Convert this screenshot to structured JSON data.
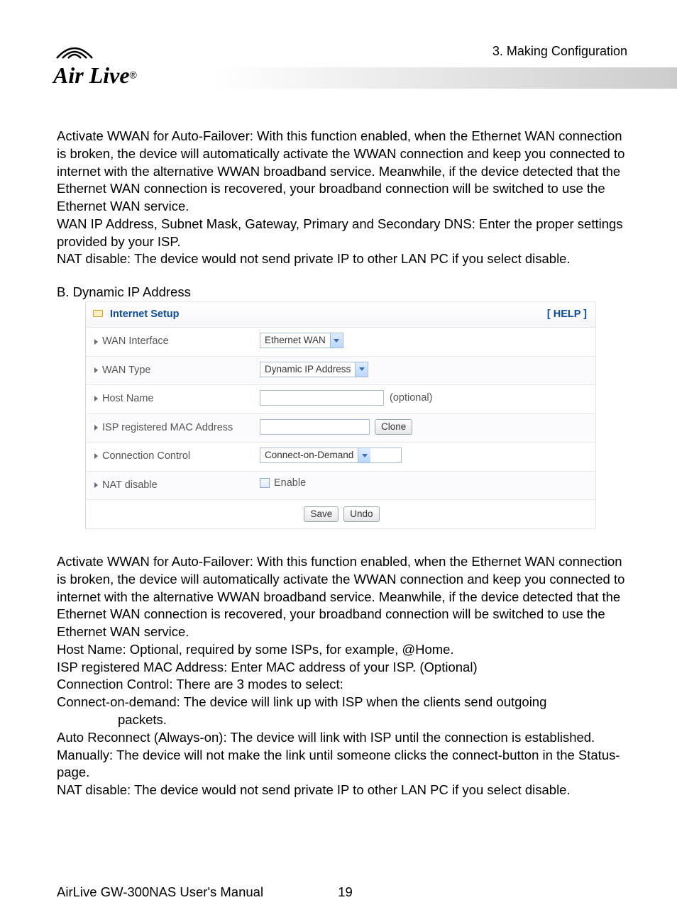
{
  "header": {
    "chapter": "3.  Making  Configuration",
    "logo_text": "Air Live",
    "logo_reg": "®"
  },
  "body_text": {
    "top_p1": "Activate WWAN for Auto-Failover: With this function enabled, when the Ethernet WAN connection is broken, the device will automatically activate the WWAN connection and keep you connected to internet with the alternative WWAN broadband service. Meanwhile, if the device detected that the Ethernet WAN connection is recovered, your broadband connection will be switched to use the Ethernet WAN service.",
    "top_p2": "WAN IP Address, Subnet Mask, Gateway, Primary and Secondary DNS: Enter the proper settings provided by your ISP.",
    "top_p3": "NAT disable: The device would not send private IP to other LAN PC if you select disable.",
    "section_b": "B. Dynamic IP Address",
    "low_p1": "Activate WWAN for Auto-Failover: With this function enabled, when the Ethernet WAN connection is broken, the device will automatically activate the WWAN connection and keep you connected to internet with the alternative WWAN broadband service. Meanwhile, if the device detected that the Ethernet WAN connection is recovered, your broadband connection will be switched to use the Ethernet WAN service.",
    "low_p2": "Host Name: Optional, required by some ISPs, for example, @Home.",
    "low_p3": "ISP registered MAC Address: Enter MAC address of your ISP. (Optional)",
    "low_p4": "Connection Control: There are 3 modes to select:",
    "low_p5a": "Connect-on-demand: The device will link up with ISP when the clients send outgoing",
    "low_p5b": "packets.",
    "low_p6": "Auto Reconnect (Always-on): The device will link with ISP until the connection is established.",
    "low_p7": "Manually: The device will not make the link until someone clicks the connect-button in the Status-page.",
    "low_p8": "NAT disable: The device would not send private IP to other LAN PC if you select disable."
  },
  "panel": {
    "title": "Internet Setup",
    "help": "[ HELP ]",
    "rows": {
      "wan_interface": {
        "label": "WAN Interface",
        "value": "Ethernet WAN"
      },
      "wan_type": {
        "label": "WAN Type",
        "value": "Dynamic IP Address"
      },
      "host_name": {
        "label": "Host Name",
        "hint": "(optional)"
      },
      "isp_mac": {
        "label": "ISP registered MAC Address",
        "button": "Clone"
      },
      "conn_control": {
        "label": "Connection Control",
        "value": "Connect-on-Demand"
      },
      "nat_disable": {
        "label": "NAT disable",
        "checkbox_label": "Enable"
      }
    },
    "buttons": {
      "save": "Save",
      "undo": "Undo"
    }
  },
  "footer": {
    "manual": "AirLive GW-300NAS User's Manual",
    "page": "19"
  }
}
